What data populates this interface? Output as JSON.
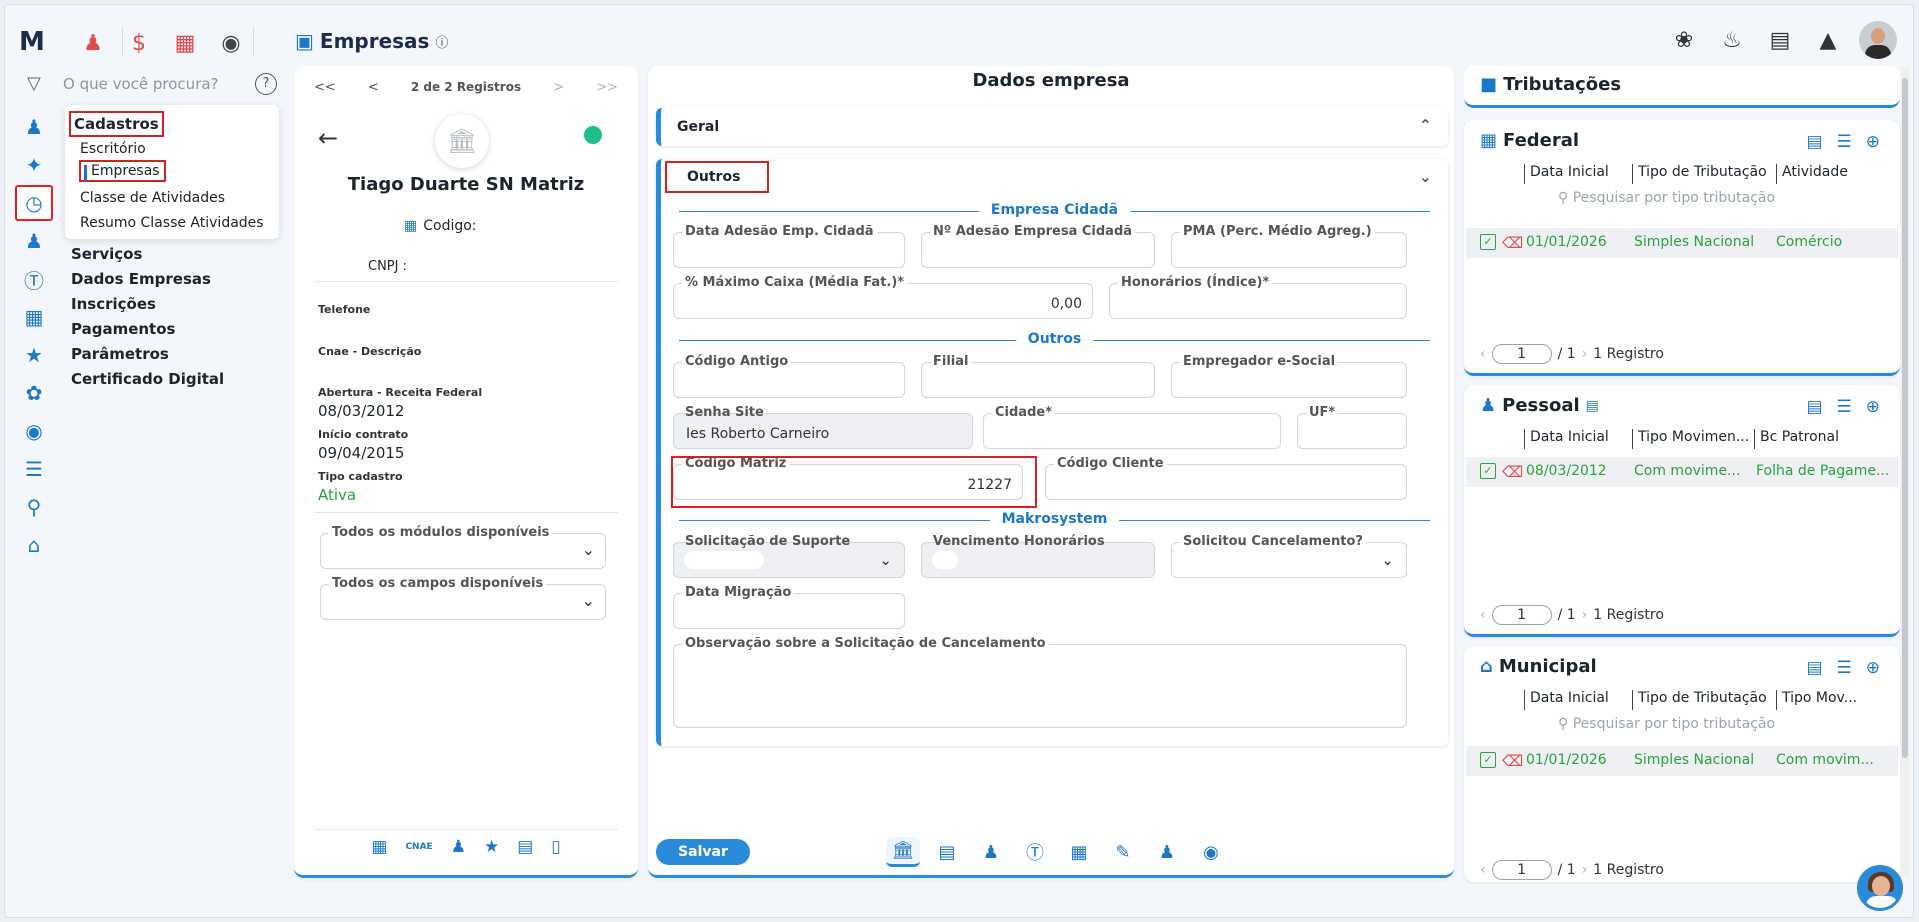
{
  "app": {
    "logo": "M",
    "page_title": "Empresas",
    "search_placeholder": "O que você procura?"
  },
  "menu": {
    "header": "Cadastros",
    "items": [
      "Escritório",
      "Empresas",
      "Classe de Atividades",
      "Resumo Classe Atividades"
    ]
  },
  "nav": [
    "Serviços",
    "Dados Empresas",
    "Inscrições",
    "Pagamentos",
    "Parâmetros",
    "Certificado Digital"
  ],
  "company": {
    "pager": {
      "first": "<<",
      "prev": "<",
      "text": "2 de 2 Registros",
      "next": ">",
      "last": ">>"
    },
    "name": "Tiago Duarte SN Matriz",
    "codigo_label": "Codigo:",
    "cnpj_label": "CNPJ : ",
    "telefone_label": "Telefone",
    "cnae_label": "Cnae - Descrição",
    "abertura_label": "Abertura - Receita Federal",
    "abertura": "08/03/2012",
    "inicio_label": "Início contrato",
    "inicio": "09/04/2015",
    "tipo_label": "Tipo cadastro",
    "tipo": "Ativa",
    "modulos_label": "Todos os módulos disponíveis",
    "campos_label": "Todos os campos disponíveis",
    "footer_cnae": "CNAE"
  },
  "dados": {
    "title": "Dados empresa",
    "geral": "Geral",
    "outros": "Outros",
    "sec_cidada": "Empresa Cidadã",
    "sec_outros": "Outros",
    "sec_makro": "Makrosystem",
    "f_data_adesao": "Data Adesão Emp. Cidadã",
    "f_num_adesao": "Nº Adesão Empresa Cidadã",
    "f_pma": "PMA (Perc. Médio Agreg.)",
    "f_max_caixa": "% Máximo Caixa (Média Fat.)*",
    "f_max_caixa_val": "0,00",
    "f_honorarios": "Honorários (Índice)*",
    "f_codigo_antigo": "Código Antigo",
    "f_filial": "Filial",
    "f_empregador": "Empregador e-Social",
    "f_senha": "Senha Site",
    "f_senha_val": "Ies Roberto Carneiro",
    "f_cidade": "Cidade*",
    "f_uf": "UF*",
    "f_codigo_matriz": "Código Matriz",
    "f_codigo_matriz_val": "21227",
    "f_codigo_cliente": "Código Cliente",
    "f_solicitacao": "Solicitação de Suporte",
    "f_vencimento": "Vencimento Honorários",
    "f_solicitou": "Solicitou Cancelamento?",
    "f_migracao": "Data Migração",
    "f_observacao": "Observação sobre a Solicitação de Cancelamento",
    "save": "Salvar"
  },
  "trib": {
    "title": "Tributações",
    "federal": {
      "title": "Federal",
      "cols": [
        "Data Inicial",
        "Tipo de Tributação",
        "Atividade"
      ],
      "search": "Pesquisar por tipo tributação",
      "row": [
        "01/01/2026",
        "Simples Nacional",
        "Comércio"
      ],
      "page": "1",
      "total": "/ 1",
      "count": "1 Registro"
    },
    "pessoal": {
      "title": "Pessoal",
      "cols": [
        "Data Inicial",
        "Tipo Movimen...",
        "Bc Patronal"
      ],
      "row": [
        "08/03/2012",
        "Com movime...",
        "Folha de Pagame..."
      ],
      "page": "1",
      "total": "/ 1",
      "count": "1 Registro"
    },
    "municipal": {
      "title": "Municipal",
      "cols": [
        "Data Inicial",
        "Tipo de Tributação",
        "Tipo Mov..."
      ],
      "search": "Pesquisar por tipo tributação",
      "row": [
        "01/01/2026",
        "Simples Nacional",
        "Com movim..."
      ],
      "page": "1",
      "total": "/ 1",
      "count": "1 Registro"
    }
  },
  "colors": {
    "accent": "#2a8bd8",
    "highlight": "#d42222",
    "success": "#2aa33c"
  }
}
